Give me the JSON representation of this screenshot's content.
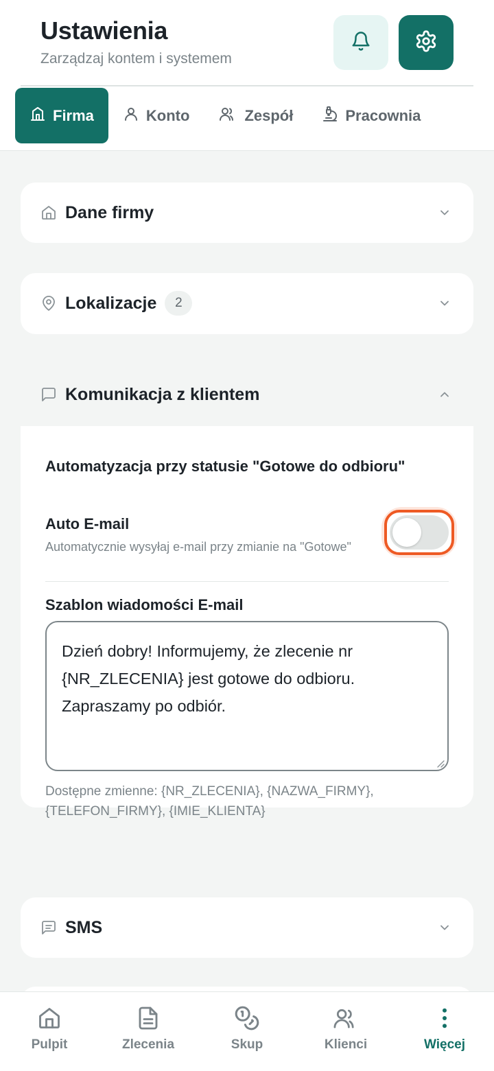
{
  "header": {
    "title": "Ustawienia",
    "subtitle": "Zarządzaj kontem i systemem",
    "bell_icon": "bell-icon",
    "gear_icon": "gear-icon"
  },
  "tabs": [
    {
      "label": "Firma",
      "icon": "building-icon",
      "active": true
    },
    {
      "label": "Konto",
      "icon": "user-icon",
      "active": false
    },
    {
      "label": "Zespół",
      "icon": "users-icon",
      "active": false
    },
    {
      "label": "Pracownia",
      "icon": "microscope-icon",
      "active": false
    }
  ],
  "sections": {
    "company": {
      "title": "Dane firmy",
      "icon": "home-icon",
      "expanded": false
    },
    "locations": {
      "title": "Lokalizacje",
      "count": "2",
      "icon": "map-pin-icon",
      "expanded": false
    },
    "communication": {
      "title": "Komunikacja z klientem",
      "icon": "message-square-icon",
      "expanded": true,
      "automation_heading": "Automatyzacja przy statusie \"Gotowe do odbioru\"",
      "auto_email": {
        "label": "Auto E-mail",
        "description": "Automatycznie wysyłaj e-mail przy zmianie na \"Gotowe\"",
        "enabled": false
      },
      "template_label": "Szablon wiadomości E-mail",
      "template_value": "Dzień dobry! Informujemy, że zlecenie nr {NR_ZLECENIA} jest gotowe do odbioru. Zapraszamy po odbiór.",
      "variables_hint": "Dostępne zmienne: {NR_ZLECENIA}, {NAZWA_FIRMY}, {TELEFON_FIRMY}, {IMIE_KLIENTA}"
    },
    "sms": {
      "title": "SMS",
      "icon": "message-text-icon",
      "expanded": false
    }
  },
  "bottom_nav": [
    {
      "label": "Pulpit",
      "icon": "home-icon",
      "active": false
    },
    {
      "label": "Zlecenia",
      "icon": "document-icon",
      "active": false
    },
    {
      "label": "Skup",
      "icon": "coins-icon",
      "active": false
    },
    {
      "label": "Klienci",
      "icon": "users-icon",
      "active": false
    },
    {
      "label": "Więcej",
      "icon": "more-vertical-icon",
      "active": true
    }
  ],
  "colors": {
    "accent": "#137066",
    "accent_light": "#e6f5f3",
    "focus_ring": "#ee5a24",
    "background": "#f3f5f4"
  }
}
